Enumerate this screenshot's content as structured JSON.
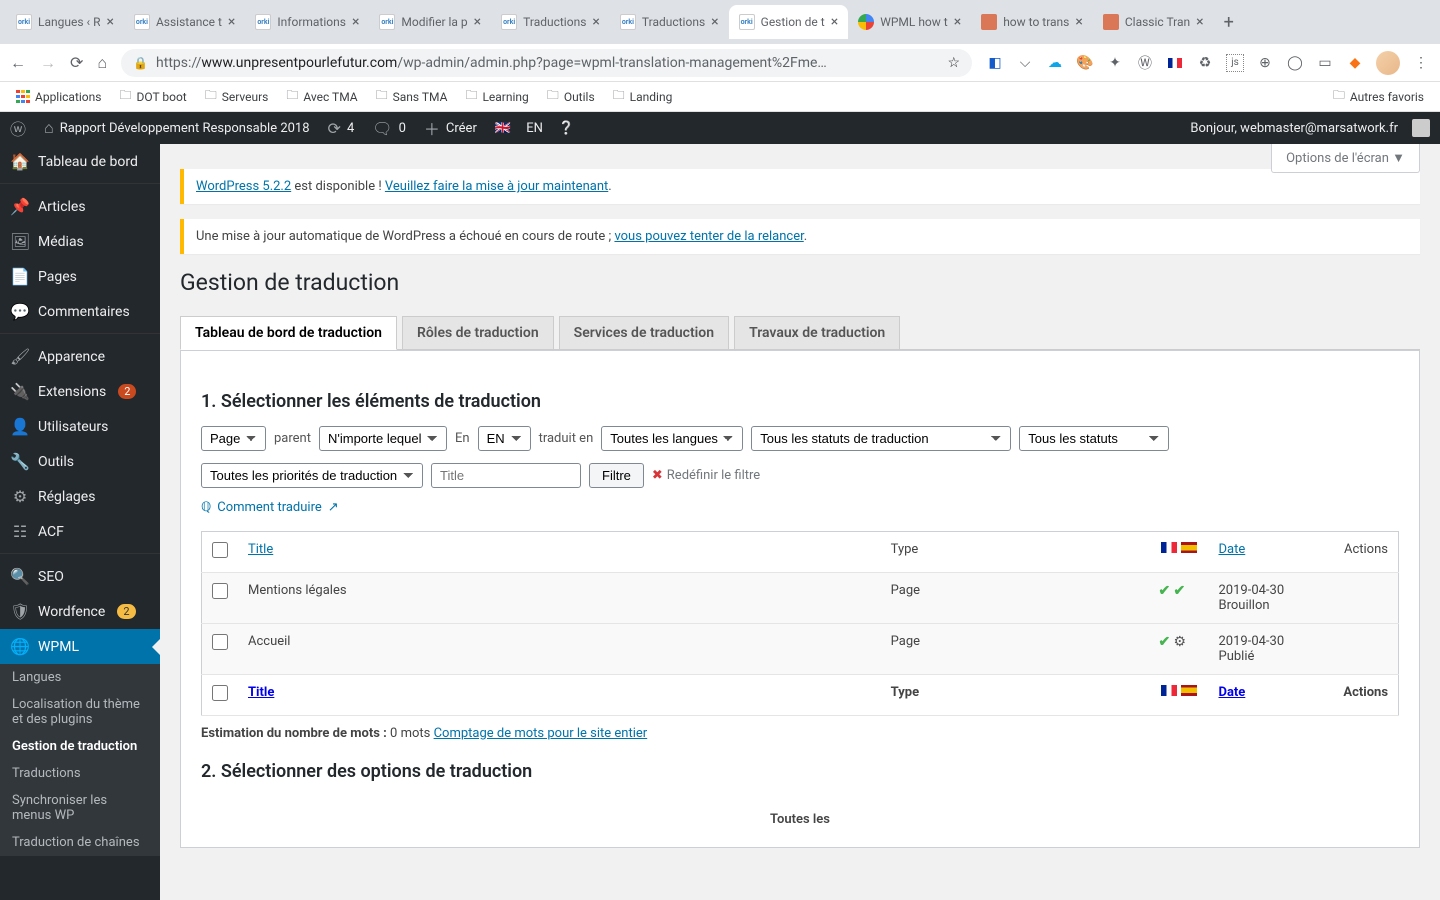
{
  "browser": {
    "tabs": [
      {
        "title": "Langues ‹ R",
        "fav": "orkit"
      },
      {
        "title": "Assistance t",
        "fav": "orkit"
      },
      {
        "title": "Informations",
        "fav": "orkit"
      },
      {
        "title": "Modifier la p",
        "fav": "orkit"
      },
      {
        "title": "Traductions",
        "fav": "orkit"
      },
      {
        "title": "Traductions",
        "fav": "orkit"
      },
      {
        "title": "Gestion de t",
        "fav": "orkit"
      },
      {
        "title": "WPML how t",
        "fav": "google"
      },
      {
        "title": "how to trans",
        "fav": "claude"
      },
      {
        "title": "Classic Tran",
        "fav": "claude"
      }
    ],
    "active_tab": 6,
    "url_prefix": "https://",
    "url_host": "www.unpresentpourlefutur.com",
    "url_path": "/wp-admin/admin.php?page=wpml-translation-management%2Fme…",
    "bookmarks": [
      "Applications",
      "DOT boot",
      "Serveurs",
      "Avec TMA",
      "Sans TMA",
      "Learning",
      "Outils",
      "Landing"
    ],
    "other_bookmarks": "Autres favoris"
  },
  "adminbar": {
    "site_name": "Rapport Développement Responsable 2018",
    "updates": "4",
    "comments": "0",
    "add_new": "Créer",
    "lang": "EN",
    "greeting": "Bonjour, webmaster@marsatwork.fr"
  },
  "sidebar": {
    "items": [
      {
        "label": "Tableau de bord",
        "icon": "🏠"
      },
      {
        "label": "Articles",
        "icon": "📌"
      },
      {
        "label": "Médias",
        "icon": "🖼"
      },
      {
        "label": "Pages",
        "icon": "📄"
      },
      {
        "label": "Commentaires",
        "icon": "💬"
      },
      {
        "label": "Apparence",
        "icon": "🖌"
      },
      {
        "label": "Extensions",
        "icon": "🔌",
        "badge": "2"
      },
      {
        "label": "Utilisateurs",
        "icon": "👤"
      },
      {
        "label": "Outils",
        "icon": "🔧"
      },
      {
        "label": "Réglages",
        "icon": "⚙"
      },
      {
        "label": "ACF",
        "icon": "☷"
      },
      {
        "label": "SEO",
        "icon": "🔍"
      },
      {
        "label": "Wordfence",
        "icon": "🛡",
        "badge": "2",
        "badgeColor": "yellow"
      },
      {
        "label": "WPML",
        "icon": "🌐"
      }
    ],
    "wpml_submenu": [
      "Langues",
      "Localisation du thème et des plugins",
      "Gestion de traduction",
      "Traductions",
      "Synchroniser les menus WP",
      "Traduction de chaînes"
    ],
    "wpml_current": 2
  },
  "content": {
    "screen_options": "Options de l'écran ▼",
    "notice1_a": "WordPress 5.2.2",
    "notice1_b": " est disponible ! ",
    "notice1_c": "Veuillez faire la mise à jour maintenant",
    "notice2_a": "Une mise à jour automatique de WordPress a échoué en cours de route ; ",
    "notice2_b": "vous pouvez tenter de la relancer",
    "page_title": "Gestion de traduction",
    "tabs": [
      "Tableau de bord de traduction",
      "Rôles de traduction",
      "Services de traduction",
      "Travaux de traduction"
    ],
    "active_tab": 0,
    "section1": "1. Sélectionner les éléments de traduction",
    "filters": {
      "type": "Page",
      "parent_lbl": "parent",
      "parent": "N'importe lequel",
      "in_lbl": "En",
      "in": "EN",
      "to_lbl": "traduit en",
      "to": "Toutes les langues",
      "status": "Tous les statuts de traduction",
      "all_status": "Tous les statuts",
      "priority": "Toutes les priorités de traduction",
      "title_ph": "Title",
      "filter_btn": "Filtre",
      "reset": "Redéfinir le filtre"
    },
    "how_to": "Comment traduire",
    "table": {
      "headers": {
        "title": "Title",
        "type": "Type",
        "date": "Date",
        "actions": "Actions"
      },
      "rows": [
        {
          "title": "Mentions légales",
          "type": "Page",
          "date": "2019-04-30",
          "status": "Brouillon",
          "fr": "check",
          "es": "check"
        },
        {
          "title": "Accueil",
          "type": "Page",
          "date": "2019-04-30",
          "status": "Publié",
          "fr": "check",
          "es": "gear"
        }
      ]
    },
    "word_est_lbl": "Estimation du nombre de mots :",
    "word_est_val": "0 mots",
    "word_est_link": "Comptage de mots pour le site entier",
    "section2": "2. Sélectionner des options de traduction",
    "all_langs_hdr": "Toutes les"
  }
}
